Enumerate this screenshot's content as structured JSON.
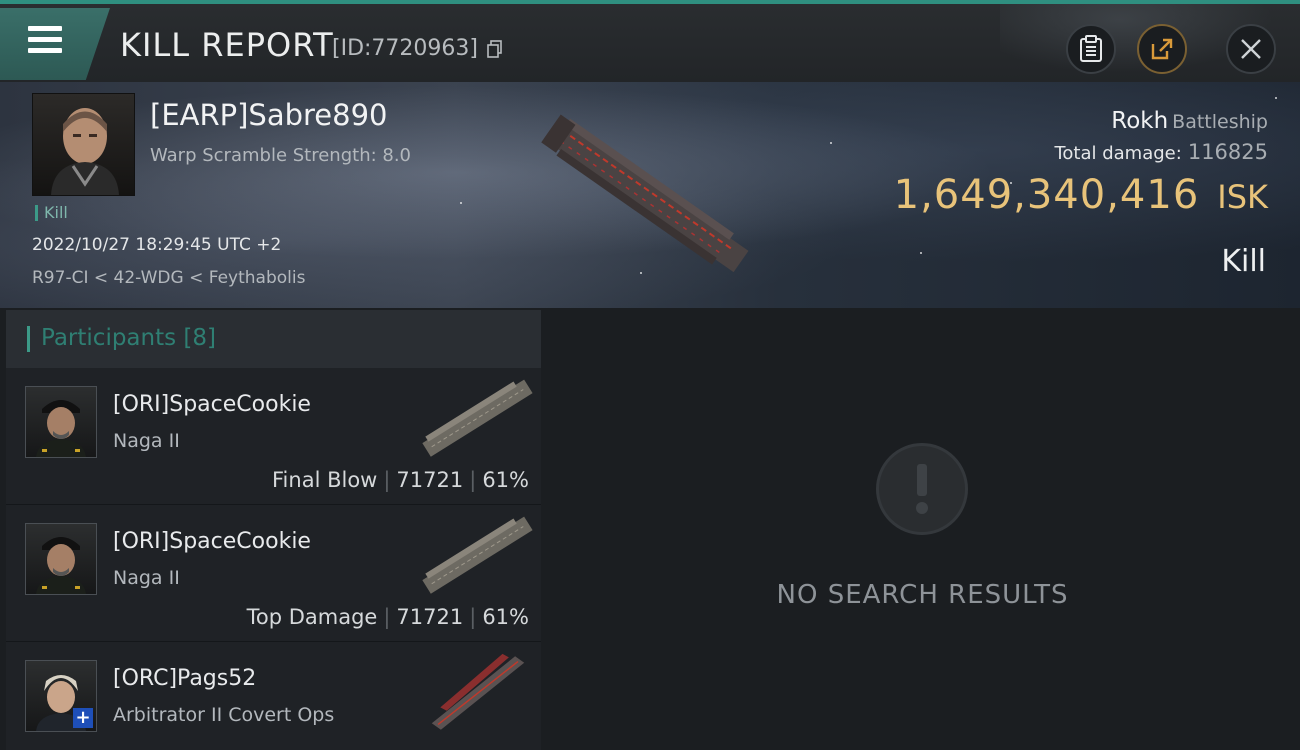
{
  "header": {
    "title": "KILL REPORT",
    "report_id": "[ID:7720963]",
    "icons": {
      "menu": "hamburger-menu-icon",
      "copy": "copy-icon",
      "clipboard": "clipboard-icon",
      "share": "share-icon",
      "close": "close-icon"
    }
  },
  "victim": {
    "name": "[EARP]Sabre890",
    "warp_scramble": "Warp Scramble Strength: 8.0",
    "tag": "Kill",
    "datetime": "2022/10/27 18:29:45 UTC +2",
    "location": "R97-CI < 42-WDG < Feythabolis",
    "ship_name": "Rokh",
    "ship_class": "Battleship",
    "total_damage_label": "Total damage:",
    "total_damage": "116825",
    "isk_value": "1,649,340,416",
    "isk_unit": "ISK",
    "result": "Kill"
  },
  "participants": {
    "title": "Participants",
    "count": "[8]",
    "items": [
      {
        "name": "[ORI]SpaceCookie",
        "ship": "Naga II",
        "role": "Final Blow",
        "damage": "71721",
        "percent": "61%"
      },
      {
        "name": "[ORI]SpaceCookie",
        "ship": "Naga II",
        "role": "Top Damage",
        "damage": "71721",
        "percent": "61%"
      },
      {
        "name": "[ORC]Pags52",
        "ship": "Arbitrator II Covert Ops",
        "role": "",
        "damage": "",
        "percent": ""
      }
    ]
  },
  "results": {
    "empty_message": "NO SEARCH RESULTS",
    "icon": "exclamation-icon"
  },
  "colors": {
    "accent": "#3c9a88",
    "isk": "#e8c37a",
    "header_top": "#2f8f80"
  }
}
